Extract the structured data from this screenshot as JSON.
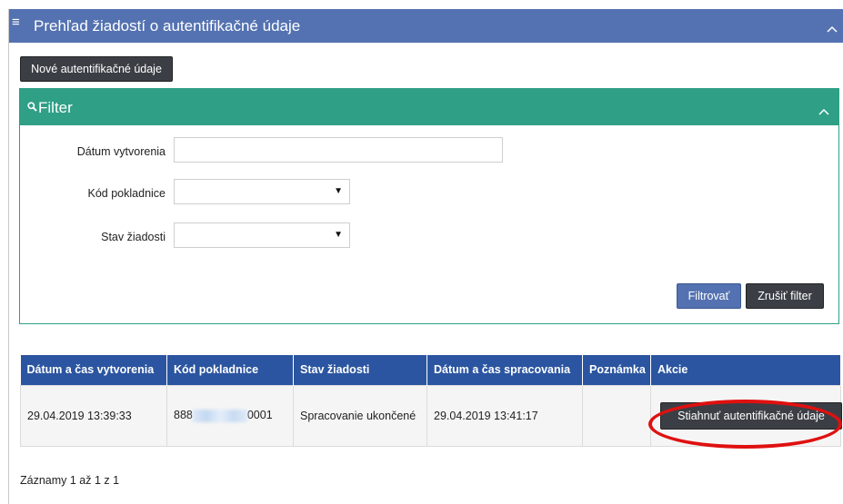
{
  "header": {
    "title": "Prehľad žiadostí o autentifikačné údaje",
    "icon": "menu-icon",
    "collapse_icon": "chevron-up-icon"
  },
  "toolbar": {
    "new_label": "Nové autentifikačné údaje"
  },
  "filter": {
    "title": "Filter",
    "icon": "search-icon",
    "fields": {
      "created_label": "Dátum vytvorenia",
      "created_value": "",
      "register_label": "Kód pokladnice",
      "register_value": "",
      "status_label": "Stav žiadosti",
      "status_value": ""
    },
    "apply_label": "Filtrovať",
    "clear_label": "Zrušiť filter"
  },
  "table": {
    "columns": [
      "Dátum a čas vytvorenia",
      "Kód pokladnice",
      "Stav žiadosti",
      "Dátum a čas spracovania",
      "Poznámka",
      "Akcie"
    ],
    "rows": [
      {
        "created": "29.04.2019 13:39:33",
        "register_prefix": "888",
        "register_suffix": "0001",
        "status": "Spracovanie ukončené",
        "processed": "29.04.2019 13:41:17",
        "note": "",
        "action_label": "Stiahnuť autentifikačné údaje"
      }
    ]
  },
  "footer": {
    "records": "Záznamy 1 až 1 z 1"
  },
  "colors": {
    "header": "#5472b1",
    "filter": "#2f9f86",
    "table_header": "#2b55a0",
    "highlight": "#e01010"
  }
}
